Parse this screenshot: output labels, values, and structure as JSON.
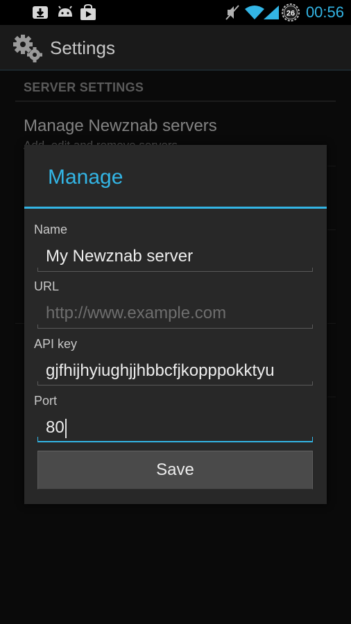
{
  "status_bar": {
    "time": "00:56",
    "battery_level": "26",
    "icons": [
      "download-icon",
      "android-icon",
      "play-store-icon",
      "mute-icon",
      "wifi-icon",
      "signal-icon",
      "battery-icon"
    ]
  },
  "action_bar": {
    "title": "Settings",
    "icon": "gear-icon"
  },
  "settings": {
    "category": "SERVER SETTINGS",
    "item_title": "Manage Newznab servers",
    "item_summary": "Add, edit and remove servers"
  },
  "dialog": {
    "title": "Manage",
    "fields": [
      {
        "label": "Name",
        "value": "My Newznab server",
        "placeholder": ""
      },
      {
        "label": "URL",
        "value": "",
        "placeholder": "http://www.example.com"
      },
      {
        "label": "API key",
        "value": "gjfhijhyiughjjhbbcfjkopppokktyu",
        "placeholder": ""
      },
      {
        "label": "Port",
        "value": "80",
        "placeholder": ""
      }
    ],
    "save_label": "Save"
  },
  "colors": {
    "accent": "#33b5e5",
    "dialog_bg": "#282828",
    "screen_bg": "#101010"
  }
}
